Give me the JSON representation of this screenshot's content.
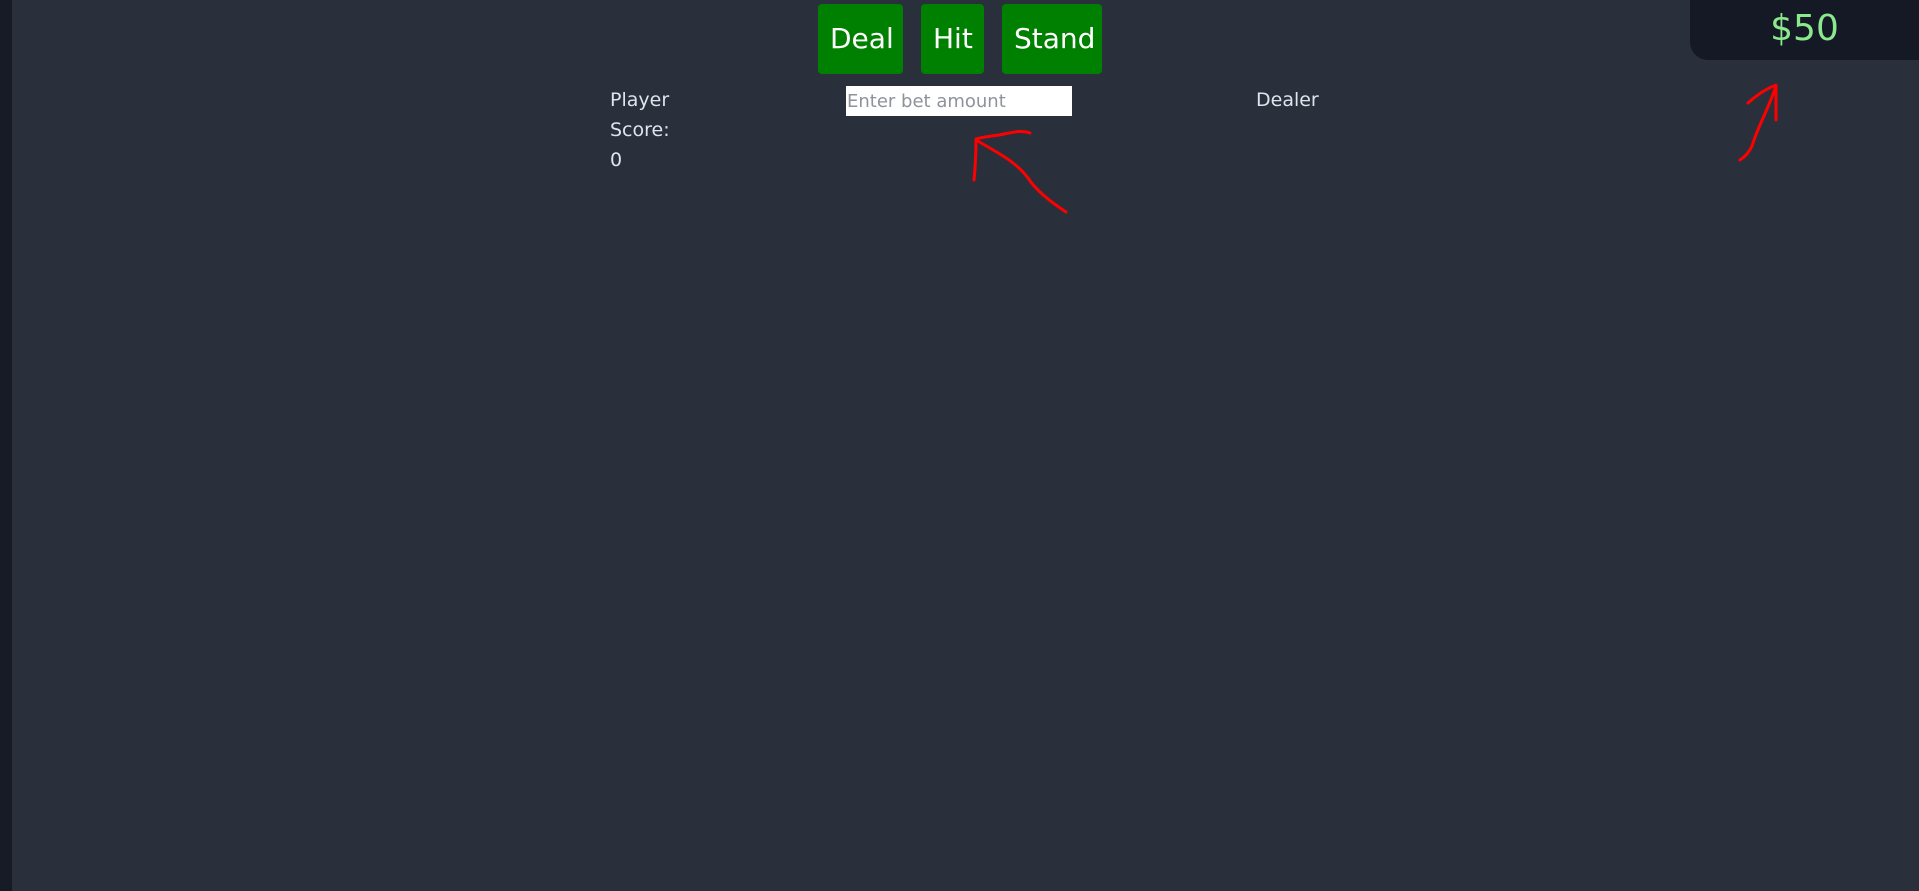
{
  "controls": {
    "deal_label": "Deal",
    "hit_label": "Hit",
    "stand_label": "Stand"
  },
  "bet": {
    "placeholder": "Enter bet amount",
    "value": ""
  },
  "player": {
    "label": "Player",
    "score_label": "Score:",
    "score": "0"
  },
  "dealer": {
    "label": "Dealer"
  },
  "balance": {
    "amount": "$50"
  },
  "colors": {
    "background": "#292f3b",
    "button": "#008000",
    "balance_text": "#8be88d",
    "annotation": "#ff0000"
  }
}
